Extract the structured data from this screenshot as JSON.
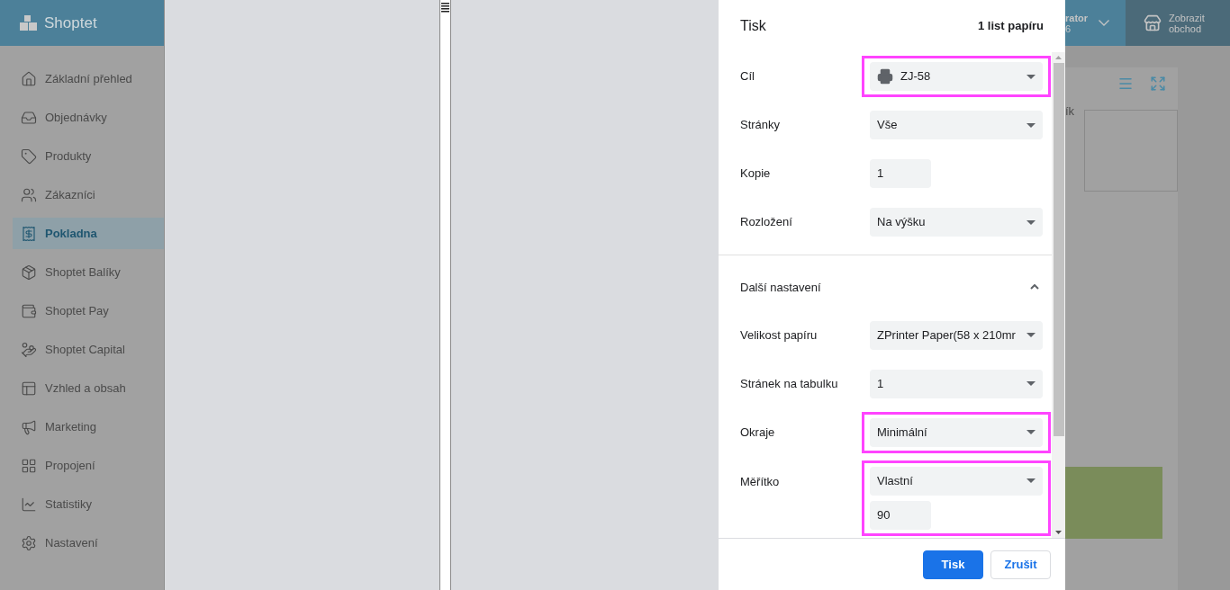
{
  "sidebar": {
    "logo": "Shoptet",
    "items": [
      {
        "label": "Základní přehled",
        "selected": false
      },
      {
        "label": "Objednávky",
        "selected": false
      },
      {
        "label": "Produkty",
        "selected": false
      },
      {
        "label": "Zákazníci",
        "selected": false
      },
      {
        "label": "Pokladna",
        "selected": true
      },
      {
        "label": "Shoptet Balíky",
        "selected": false
      },
      {
        "label": "Shoptet Pay",
        "selected": false
      },
      {
        "label": "Shoptet Capital",
        "selected": false
      },
      {
        "label": "Vzhled a obsah",
        "selected": false
      },
      {
        "label": "Marketing",
        "selected": false
      },
      {
        "label": "Propojení",
        "selected": false
      },
      {
        "label": "Statistiky",
        "selected": false
      },
      {
        "label": "Nastavení",
        "selected": false
      }
    ]
  },
  "topbar": {
    "user_name": "rator",
    "user_sub": "6",
    "shop_button": "Zobrazit obchod"
  },
  "content": {
    "card_label": "ík"
  },
  "print": {
    "title": "Tisk",
    "sheet_count": "1 list papíru",
    "settings": [
      {
        "label": "Cíl",
        "kind": "select",
        "value": "ZJ-58",
        "highlighted": true,
        "printer": true
      },
      {
        "label": "Stránky",
        "kind": "select",
        "value": "Vše",
        "highlighted": false
      },
      {
        "label": "Kopie",
        "kind": "number",
        "value": "1",
        "highlighted": false
      },
      {
        "label": "Rozložení",
        "kind": "select",
        "value": "Na výšku",
        "highlighted": false
      }
    ],
    "more": {
      "label": "Další nastavení",
      "expanded": true
    },
    "more_settings": [
      {
        "label": "Velikost papíru",
        "kind": "select",
        "value": "ZPrinter Paper(58 x 210mr",
        "highlighted": false
      },
      {
        "label": "Stránek na tabulku",
        "kind": "select",
        "value": "1",
        "highlighted": false
      },
      {
        "label": "Okraje",
        "kind": "select",
        "value": "Minimální",
        "highlighted": true
      },
      {
        "label": "Měřítko",
        "kind": "select",
        "value": "Vlastní",
        "custom_value": "90",
        "highlighted": true
      }
    ],
    "buttons": [
      {
        "label": "Tisk",
        "kind": "primary"
      },
      {
        "label": "Zrušit",
        "kind": "secondary"
      }
    ]
  }
}
